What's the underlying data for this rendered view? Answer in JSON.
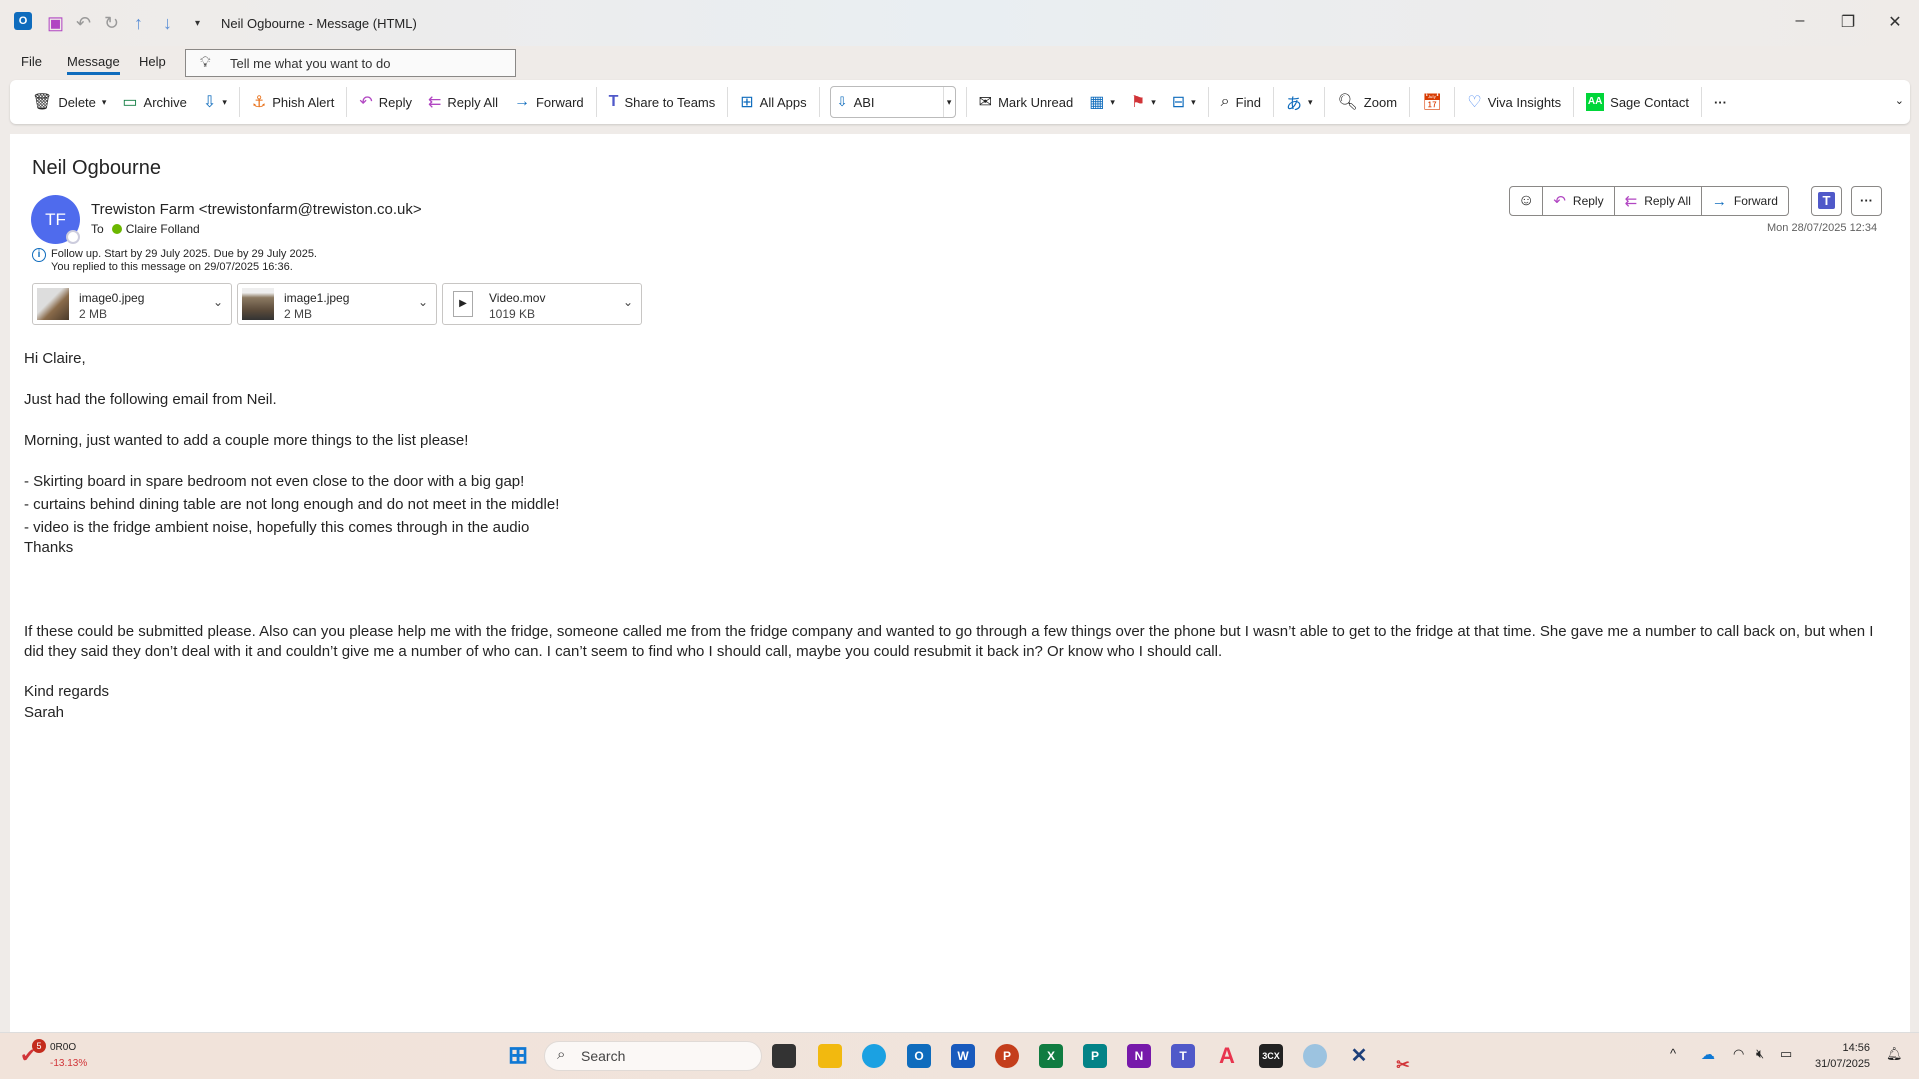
{
  "window": {
    "title": "Neil Ogbourne  -  Message (HTML)",
    "minimize": "–",
    "restore": "❐",
    "close": "✕"
  },
  "menu": {
    "file": "File",
    "message": "Message",
    "help": "Help",
    "tellme_placeholder": "Tell me what you want to do"
  },
  "ribbon": {
    "delete": "Delete",
    "archive": "Archive",
    "phish_alert": "Phish Alert",
    "reply": "Reply",
    "reply_all": "Reply All",
    "forward": "Forward",
    "share_teams": "Share to Teams",
    "all_apps": "All Apps",
    "abi": "ABI",
    "mark_unread": "Mark Unread",
    "find": "Find",
    "zoom": "Zoom",
    "viva_insights": "Viva Insights",
    "sage_contact": "Sage Contact",
    "more": "···"
  },
  "message": {
    "subject": "Neil Ogbourne",
    "avatar_initials": "TF",
    "sender": "Trewiston Farm <trewistonfarm@trewiston.co.uk>",
    "to_label": "To",
    "recipient": "Claire Folland",
    "followup": "Follow up.  Start by 29 July 2025.  Due by 29 July 2025.",
    "replied": "You replied to this message on 29/07/2025 16:36.",
    "date": "Mon 28/07/2025 12:34",
    "actions": {
      "reply": "Reply",
      "reply_all": "Reply All",
      "forward": "Forward",
      "more": "···"
    },
    "attachments": [
      {
        "name": "image0.jpeg",
        "size": "2 MB"
      },
      {
        "name": "image1.jpeg",
        "size": "2 MB"
      },
      {
        "name": "Video.mov",
        "size": "1019 KB"
      }
    ],
    "body": {
      "greeting": "Hi Claire,",
      "line1": "Just had the following email from Neil.",
      "line2": "Morning, just wanted to add a couple more things to the list please!",
      "bullets": [
        "- Skirting board in spare bedroom not even close to the door with a big gap!",
        "- curtains behind dining table are not long enough and do not meet in the middle!",
        "- video is the fridge ambient noise, hopefully this comes through in the audio"
      ],
      "thanks": "Thanks",
      "paragraph": "If these could be submitted please. Also can you please help me with the fridge, someone called me from the fridge company and wanted to go through a few things over the phone but I wasn’t able to get to the fridge at that time. She gave me a number to call back on, but when I did they said they don’t deal with it and couldn’t give me a number of who can. I can’t seem to find who I should call, maybe you could resubmit it back in? Or know who I should call.",
      "signoff": "Kind regards",
      "name": "Sarah"
    }
  },
  "taskbar": {
    "stock_badge": "5",
    "stock_name": "0R0O",
    "stock_change": "-13.13%",
    "search": "Search",
    "time": "14:56",
    "date": "31/07/2025"
  },
  "colors": {
    "accent": "#0f6cbd",
    "avatar": "#4f6bed",
    "reply_icon": "#b146c2",
    "forward_icon": "#0f6cbd",
    "stock_negative": "#d13438"
  }
}
